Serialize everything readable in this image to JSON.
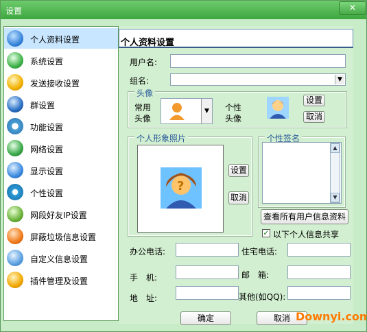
{
  "window": {
    "title": "设置",
    "close": "×"
  },
  "sidebar": {
    "items": [
      {
        "label": "个人资料设置",
        "icon": "person-icon",
        "color": "#3b8be0"
      },
      {
        "label": "系统设置",
        "icon": "gear-wheel-icon",
        "color": "#3fb24a"
      },
      {
        "label": "发送接收设置",
        "icon": "send-receive-icon",
        "color": "#f2b100"
      },
      {
        "label": "群设置",
        "icon": "globe-icon",
        "color": "#2a6fc4"
      },
      {
        "label": "功能设置",
        "icon": "function-icon",
        "color": "#4aa0d8"
      },
      {
        "label": "网络设置",
        "icon": "network-icon",
        "color": "#3aa84a"
      },
      {
        "label": "显示设置",
        "icon": "display-icon",
        "color": "#3b8be0"
      },
      {
        "label": "个性设置",
        "icon": "star-icon",
        "color": "#2a9ad8"
      },
      {
        "label": "网段好友IP设置",
        "icon": "ip-icon",
        "color": "#6ab23a"
      },
      {
        "label": "屏蔽垃圾信息设置",
        "icon": "block-icon",
        "color": "#f07a1a"
      },
      {
        "label": "自定义信息设置",
        "icon": "custom-info-icon",
        "color": "#5aa0e0"
      },
      {
        "label": "插件管理及设置",
        "icon": "plugin-icon",
        "color": "#f2a800"
      }
    ]
  },
  "main": {
    "title": "个人资料设置",
    "username_label": "用户名:",
    "username_value": "",
    "group_label": "组名:",
    "group_value": "",
    "avatar": {
      "group_title": "头像",
      "common_label_1": "常用",
      "common_label_2": "头像",
      "personal_label_1": "个性",
      "personal_label_2": "头像",
      "set_button": "设置",
      "cancel_button": "取消"
    },
    "photo": {
      "group_title": "个人形象照片",
      "set_button": "设置",
      "cancel_button": "取消"
    },
    "signature": {
      "group_title": "个性签名",
      "value": ""
    },
    "view_all_button": "查看所有用户信息资料",
    "share_checkbox": {
      "label": "以下个人信息共享",
      "checked": true,
      "mark": "✓"
    },
    "office_phone_label": "办公电话:",
    "home_phone_label": "住宅电话:",
    "mobile_label": "手　机:",
    "email_label": "邮　箱:",
    "address_label": "地　址:",
    "other_label": "其他(如QQ):",
    "office_phone_value": "",
    "home_phone_value": "",
    "mobile_value": "",
    "email_value": "",
    "address_value": "",
    "other_value": ""
  },
  "footer": {
    "ok_button": "确定",
    "cancel_button": "取消"
  },
  "watermark": "Downyi.com"
}
